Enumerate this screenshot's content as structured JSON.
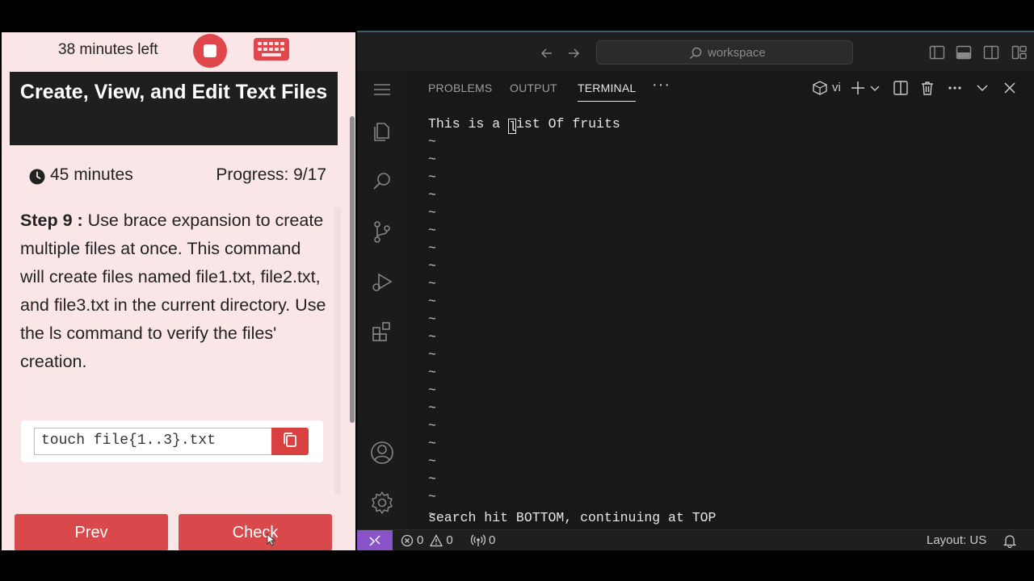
{
  "lab": {
    "time_left": "38 minutes left",
    "title": "Create, View, and Edit Text Files",
    "duration": "45 minutes",
    "progress": "Progress: 9/17",
    "step": {
      "label": "Step 9 :",
      "text": "Use brace expansion to create multiple files at once. This command will create files named file1.txt, file2.txt, and file3.txt in the current directory. Use the ls command to verify the files' creation."
    },
    "command": "touch file{1..3}.txt",
    "prev_label": "Prev",
    "check_label": "Check",
    "icons": [
      "stop-icon",
      "keyboard-icon",
      "clock-icon",
      "copy-icon"
    ],
    "colors": {
      "accent": "#d9484a",
      "panel_bg": "#fae6e6",
      "title_bg": "#1f1f1f"
    }
  },
  "ide": {
    "search_label": "workspace",
    "tabs": [
      {
        "label": "PROBLEMS",
        "active": false
      },
      {
        "label": "OUTPUT",
        "active": false
      },
      {
        "label": "TERMINAL",
        "active": true
      }
    ],
    "more_label": "···",
    "terminal_shell": "vi",
    "terminal": {
      "line_before_cursor": "This is a ",
      "cursor_char": "l",
      "line_after_cursor": "ist Of fruits",
      "tilde": "~",
      "tilde_count": 22,
      "status_line": "search hit BOTTOM, continuing at TOP"
    },
    "statusbar": {
      "errors": "0",
      "warnings": "0",
      "ports": "0",
      "layout": "Layout: US"
    },
    "activity_icons": [
      "menu-icon",
      "explorer-icon",
      "search-icon",
      "source-control-icon",
      "run-debug-icon",
      "extensions-icon",
      "account-icon",
      "settings-gear-icon"
    ],
    "colors": {
      "bg": "#1f1f1f",
      "panel": "#181818",
      "remote": "#8a54c9"
    }
  }
}
